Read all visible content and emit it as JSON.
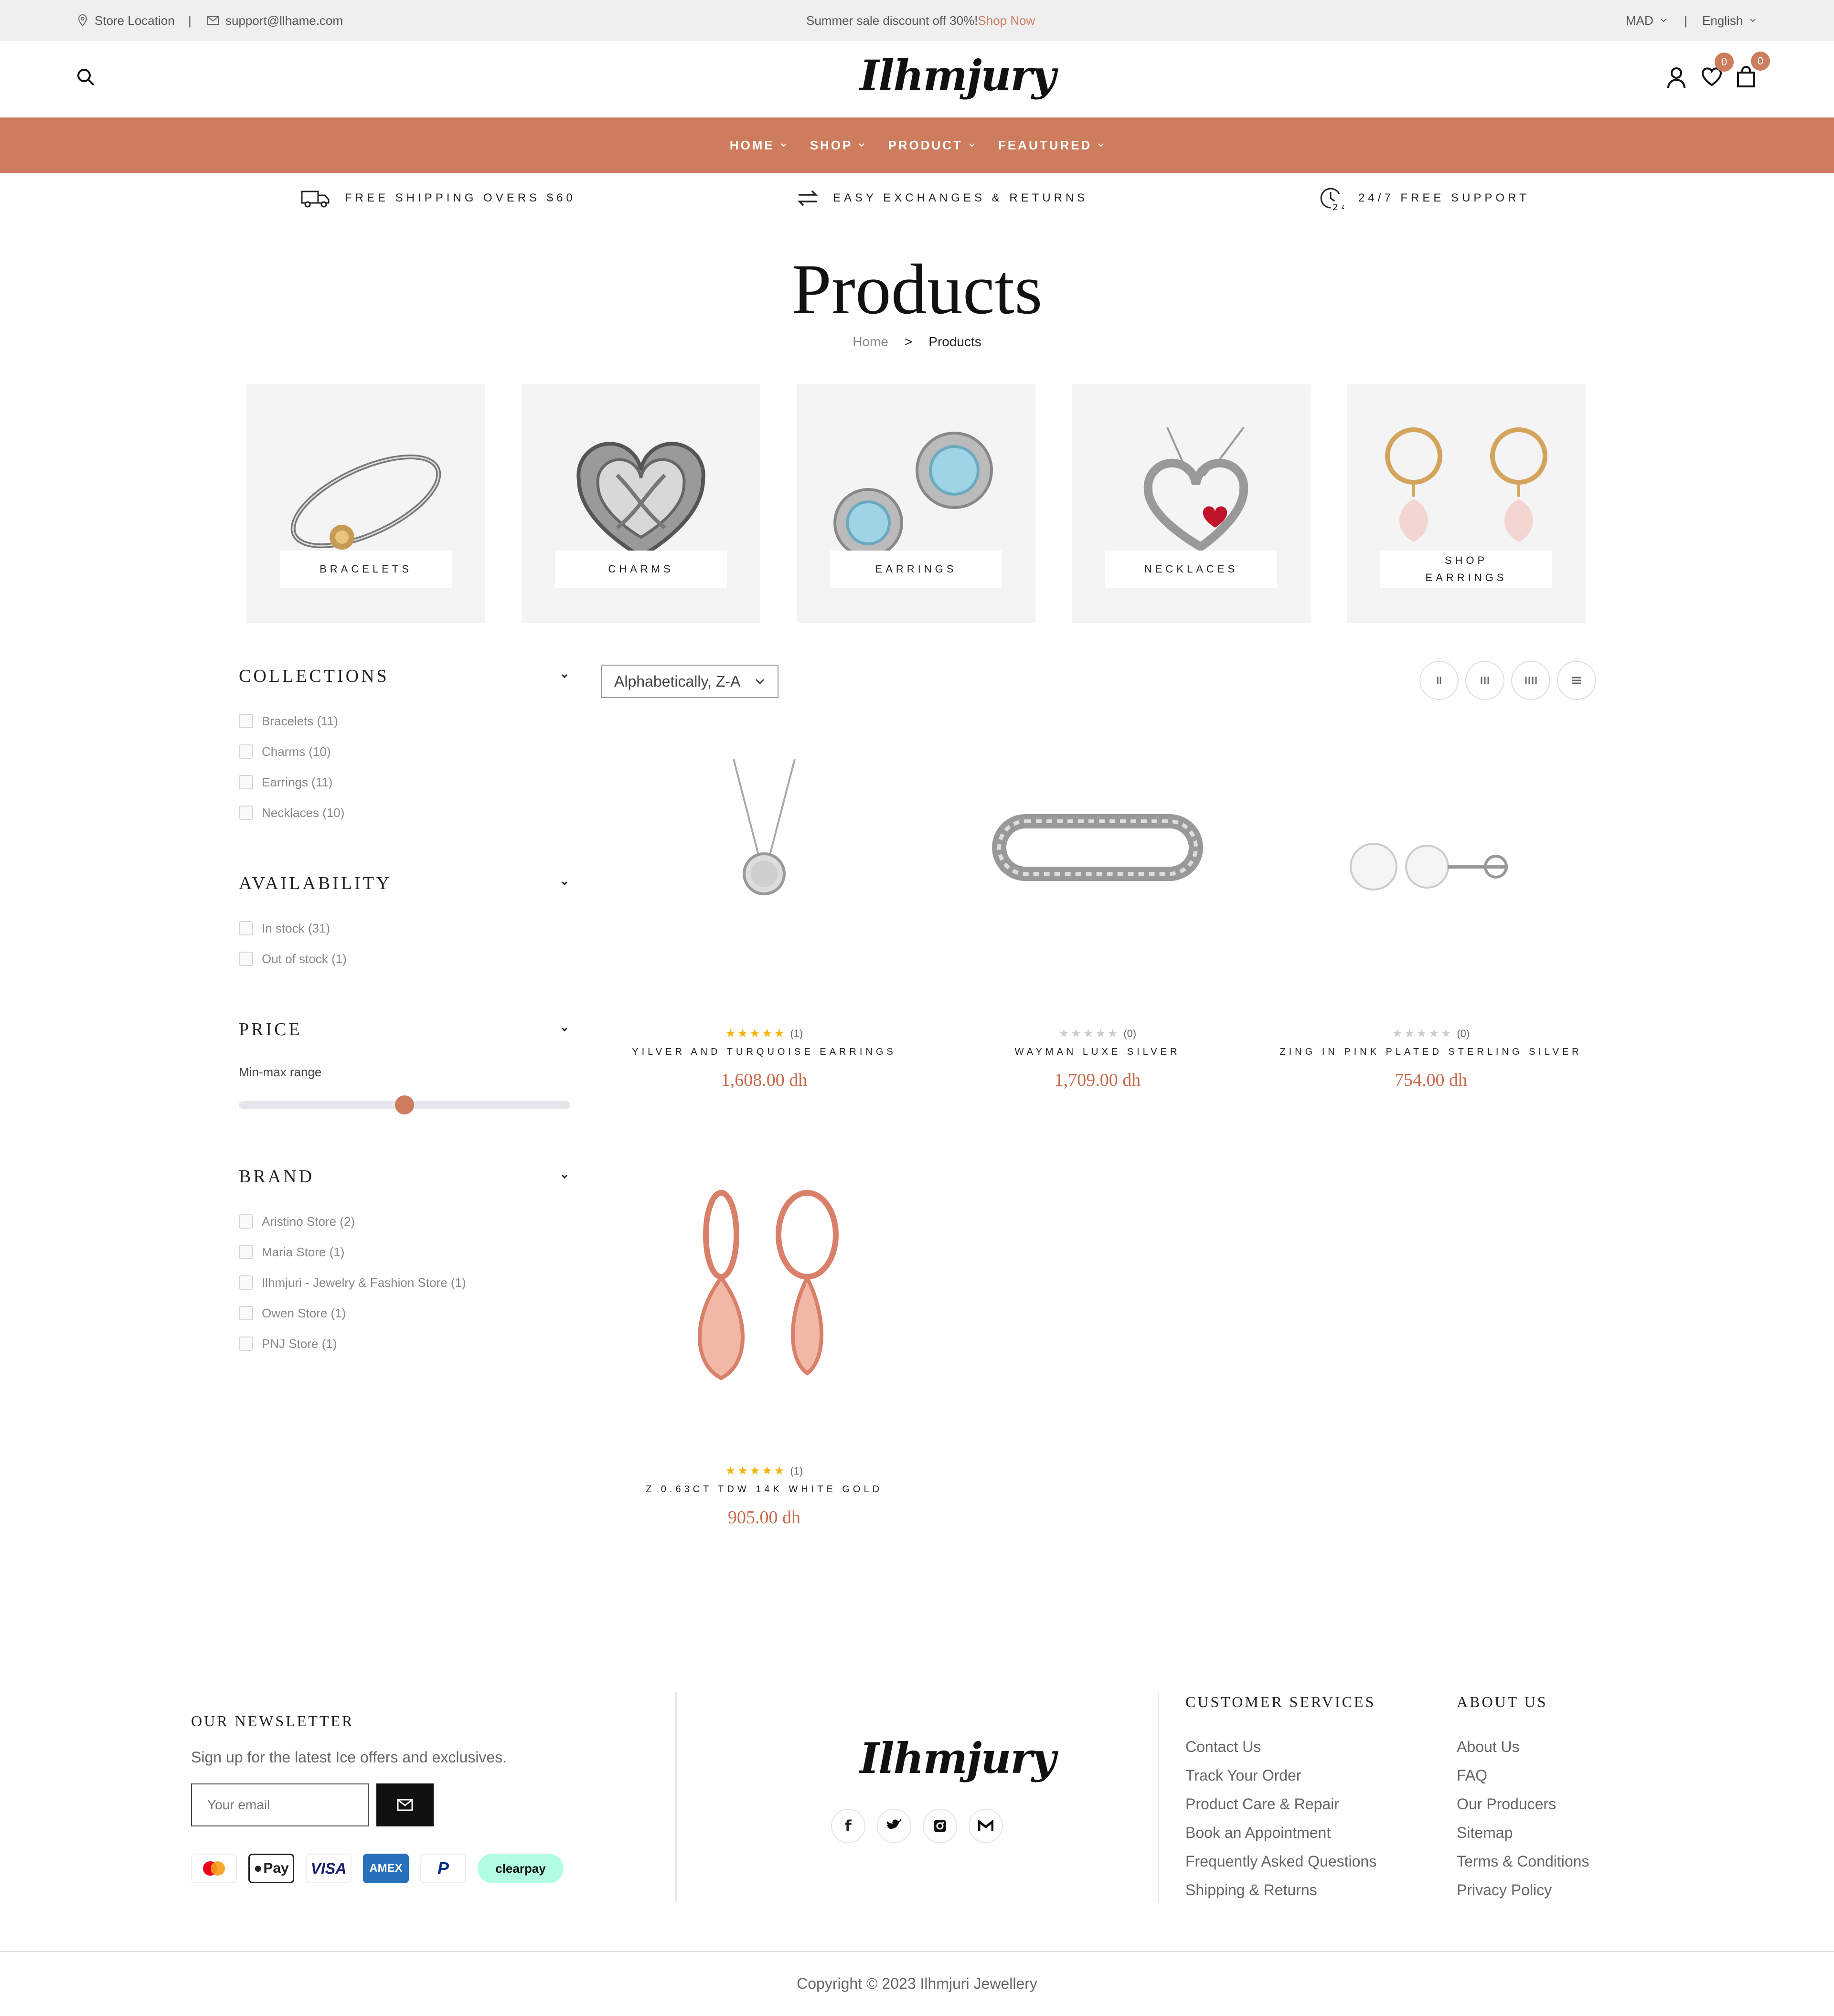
{
  "topbar": {
    "store_location": "Store Location",
    "separator": "|",
    "email": "support@llhame.com",
    "promo_text": "Summer sale discount off 30%!",
    "promo_link": "Shop Now",
    "currency": "MAD",
    "language": "English"
  },
  "header": {
    "logo": "Ilhmjury",
    "wishlist_count": "0",
    "cart_count": "0"
  },
  "nav": [
    "HOME",
    "SHOP",
    "PRODUCT",
    "FEAUTURED"
  ],
  "features": [
    {
      "icon": "truck-icon",
      "label": "FREE SHIPPING OVERS $60"
    },
    {
      "icon": "exchange-icon",
      "label": "EASY EXCHANGES & RETURNS"
    },
    {
      "icon": "support-24-icon",
      "label": "24/7 FREE SUPPORT"
    }
  ],
  "page": {
    "title": "Products",
    "breadcrumb": {
      "home": "Home",
      "sep": ">",
      "current": "Products"
    }
  },
  "categories": [
    "BRACELETS",
    "CHARMS",
    "EARRINGS",
    "NECKLACES",
    "SHOP EARRINGS"
  ],
  "filters": {
    "collections": {
      "title": "COLLECTIONS",
      "options": [
        "Bracelets (11)",
        "Charms (10)",
        "Earrings (11)",
        "Necklaces (10)"
      ]
    },
    "availability": {
      "title": "AVAILABILITY",
      "options": [
        "In stock (31)",
        "Out of stock (1)"
      ]
    },
    "price": {
      "title": "PRICE",
      "range_label": "Min-max range",
      "slider_value": 0.5
    },
    "brand": {
      "title": "BRAND",
      "options": [
        "Aristino Store (2)",
        "Maria Store (1)",
        "Ilhmjuri - Jewelry & Fashion Store (1)",
        "Owen Store (1)",
        "PNJ Store (1)"
      ]
    }
  },
  "toolbar": {
    "sort_value": "Alphabetically, Z-A",
    "views": [
      "grid-2-icon",
      "grid-3-icon",
      "grid-4-icon",
      "list-icon"
    ]
  },
  "products": [
    {
      "name": "YILVER AND TURQUOISE EARRINGS",
      "price": "1,608.00 dh",
      "rating": 5,
      "reviews": "(1)"
    },
    {
      "name": "WAYMAN LUXE SILVER",
      "price": "1,709.00 dh",
      "rating": 0,
      "reviews": "(0)"
    },
    {
      "name": "ZING IN PINK PLATED STERLING SILVER",
      "price": "754.00 dh",
      "rating": 0,
      "reviews": "(0)"
    },
    {
      "name": "Z 0.63CT TDW 14K WHITE GOLD",
      "price": "905.00 dh",
      "rating": 5,
      "reviews": "(1)"
    }
  ],
  "footer": {
    "newsletter_title": "OUR NEWSLETTER",
    "newsletter_text": "Sign up for the latest Ice offers and exclusives.",
    "email_placeholder": "Your email",
    "logo": "Ilhmjury",
    "customer_services": {
      "title": "CUSTOMER SERVICES",
      "links": [
        "Contact Us",
        "Track Your Order",
        "Product Care & Repair",
        "Book an Appointment",
        "Frequently Asked Questions",
        "Shipping & Returns"
      ]
    },
    "about": {
      "title": "ABOUT US",
      "links": [
        "About Us",
        "FAQ",
        "Our Producers",
        "Sitemap",
        "Terms & Conditions",
        "Privacy Policy"
      ]
    },
    "payments": [
      "mastercard-icon",
      "apple-pay-icon",
      "visa-icon",
      "amex-icon",
      "paypal-icon",
      "clearpay-icon"
    ],
    "pay_labels": {
      "applepay": "Pay",
      "visa": "VISA",
      "amex": "AMEX",
      "paypal": "P",
      "clearpay": "clearpay"
    },
    "copyright": "Copyright © 2023 Ilhmjuri Jewellery"
  },
  "colors": {
    "accent": "#cd7d5d",
    "price": "#c86a4a",
    "star": "#f5b301"
  }
}
